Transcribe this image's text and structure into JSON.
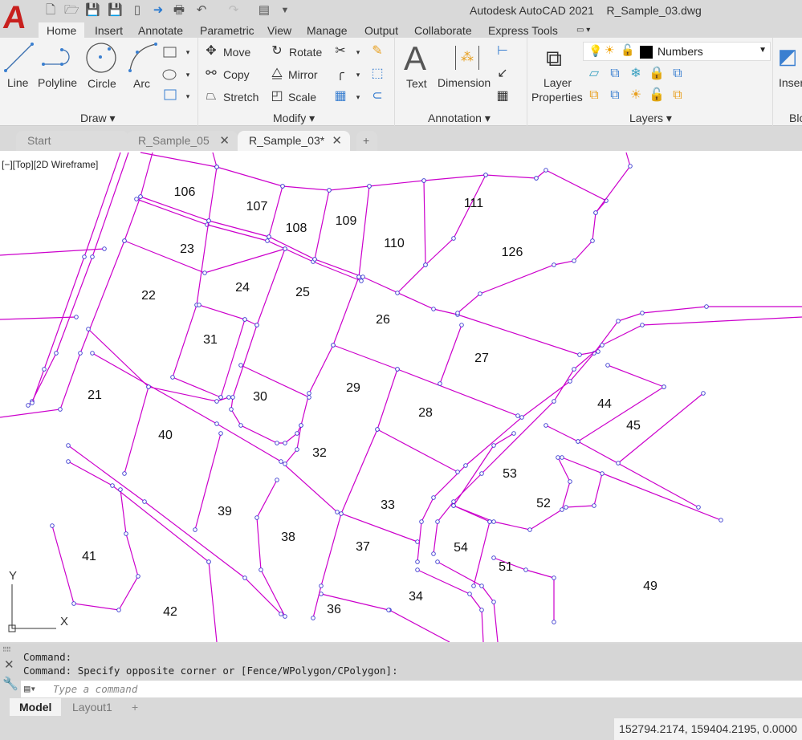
{
  "app": {
    "title": "Autodesk AutoCAD 2021",
    "document": "R_Sample_03.dwg",
    "logo": "A"
  },
  "quick_access": [
    "new-icon",
    "open-icon",
    "save-icon",
    "save-as-icon",
    "open-web-icon",
    "share-icon",
    "plot-icon",
    "undo-icon",
    "redo-icon",
    "workspace-icon",
    "customize-icon"
  ],
  "ribbon_tabs": [
    "Home",
    "Insert",
    "Annotate",
    "Parametric",
    "View",
    "Manage",
    "Output",
    "Collaborate",
    "Express Tools"
  ],
  "ribbon": {
    "draw": {
      "label": "Draw",
      "line": "Line",
      "polyline": "Polyline",
      "circle": "Circle",
      "arc": "Arc"
    },
    "modify": {
      "label": "Modify",
      "move": "Move",
      "rotate": "Rotate",
      "copy": "Copy",
      "mirror": "Mirror",
      "stretch": "Stretch",
      "scale": "Scale"
    },
    "annotation": {
      "label": "Annotation",
      "text": "Text",
      "dimension": "Dimension"
    },
    "layers": {
      "label": "Layers",
      "properties_line1": "Layer",
      "properties_line2": "Properties",
      "current_layer": "Numbers",
      "layer_color": "#000000"
    },
    "block": {
      "insert": "Inser",
      "label": "Blo"
    }
  },
  "file_tabs": [
    {
      "label": "Start"
    },
    {
      "label": "R_Sample_05"
    },
    {
      "label": "R_Sample_03*",
      "active": true
    }
  ],
  "viewport": {
    "label": "[−][Top][2D Wireframe]",
    "line_color": "#cc00cc",
    "vertex_color": "#3a3ad0",
    "ucs_x": "X",
    "ucs_y": "Y"
  },
  "drawing": {
    "parcels": [
      "106",
      "107",
      "108",
      "109",
      "110",
      "111",
      "126",
      "23",
      "24",
      "25",
      "22",
      "26",
      "31",
      "27",
      "21",
      "30",
      "29",
      "28",
      "44",
      "45",
      "40",
      "32",
      "53",
      "52",
      "33",
      "39",
      "38",
      "37",
      "54",
      "51",
      "41",
      "49",
      "34",
      "36",
      "42"
    ]
  },
  "command": {
    "history": [
      "Command:",
      "Command: Specify opposite corner or [Fence/WPolygon/CPolygon]:"
    ],
    "placeholder": "Type a command"
  },
  "layout_tabs": [
    "Model",
    "Layout1"
  ],
  "status": {
    "coordinates": "152794.2174, 159404.2195, 0.0000"
  }
}
